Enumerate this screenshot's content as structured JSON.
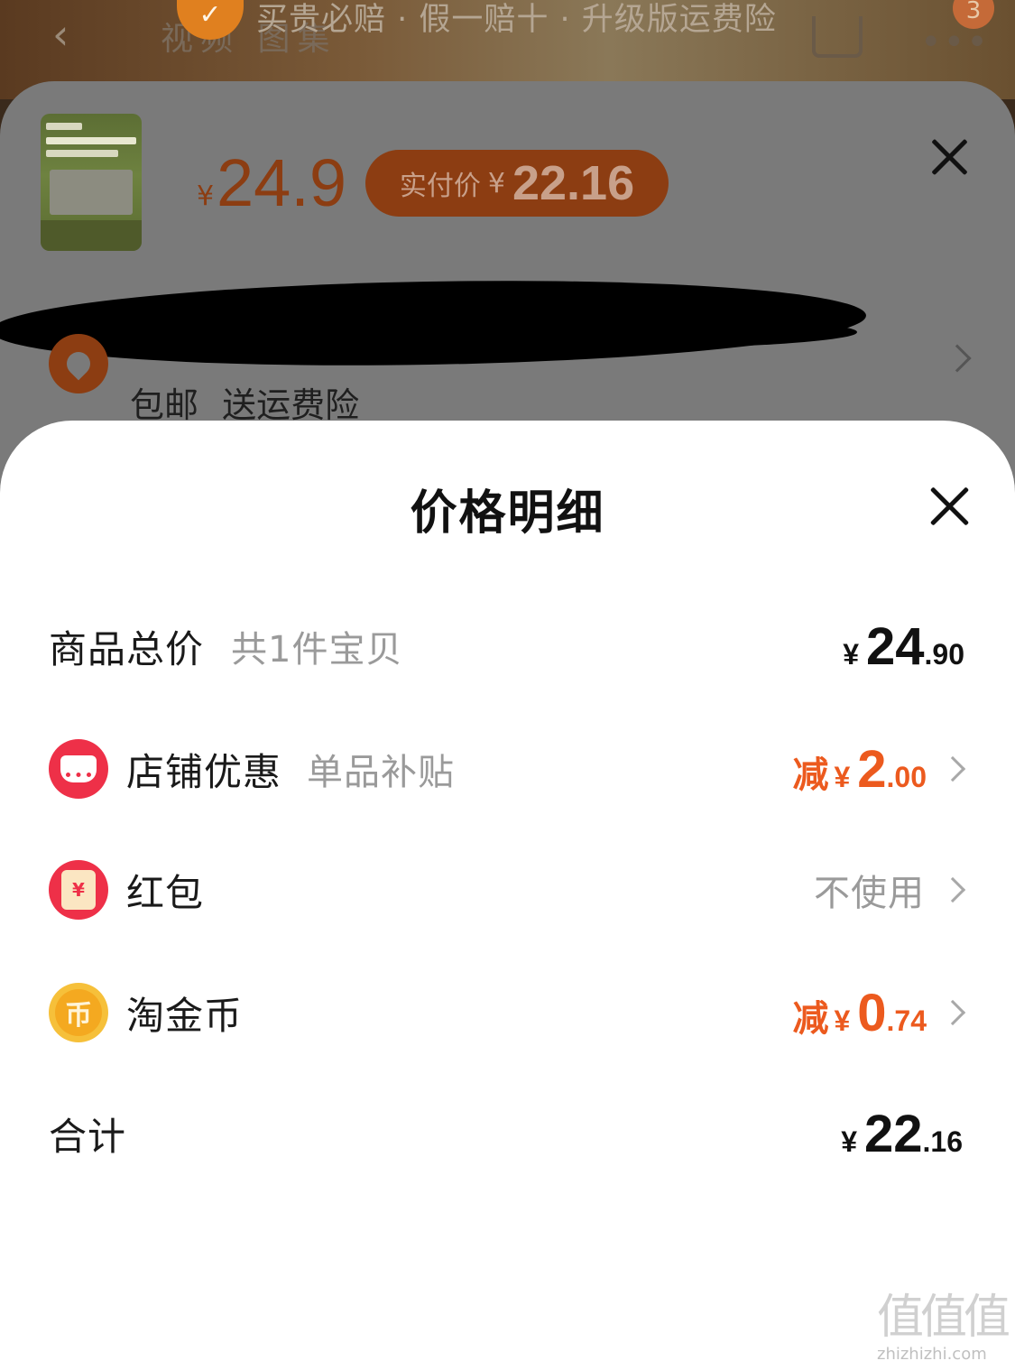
{
  "bg": {
    "back_icon": "chevron-left-icon",
    "tabs_text": "视频 图集",
    "guarantee_shield_glyph": "✓",
    "guarantee_text": "买贵必赔 · 假一赔十 · 升级版运费险",
    "cart_badge": "3"
  },
  "sku": {
    "yen": "¥",
    "price": "24.9",
    "pay_label": "实付价",
    "pay_yen": "¥",
    "pay_price": "22.16",
    "shipping": "包邮 送运费险"
  },
  "sheet": {
    "title": "价格明细",
    "rows": {
      "goods": {
        "label": "商品总价",
        "sub": "共1件宝贝",
        "cur": "¥",
        "int": "24",
        "dec": ".90"
      },
      "store": {
        "label": "店铺优惠",
        "sub": "单品补贴",
        "pre": "减",
        "cur": "¥",
        "int": "2",
        "dec": ".00"
      },
      "redpack": {
        "label": "红包",
        "value": "不使用",
        "glyph": "¥"
      },
      "coin": {
        "label": "淘金币",
        "pre": "减",
        "cur": "¥",
        "int": "0",
        "dec": ".74",
        "glyph": "币"
      },
      "total": {
        "label": "合计",
        "cur": "¥",
        "int": "22",
        "dec": ".16"
      }
    }
  },
  "watermark": {
    "logo": "值值值",
    "url": "zhizhizhi.com"
  },
  "colors": {
    "accent": "#ec5a1e",
    "store_red": "#ee3048",
    "coin_gold": "#f6c03a"
  }
}
